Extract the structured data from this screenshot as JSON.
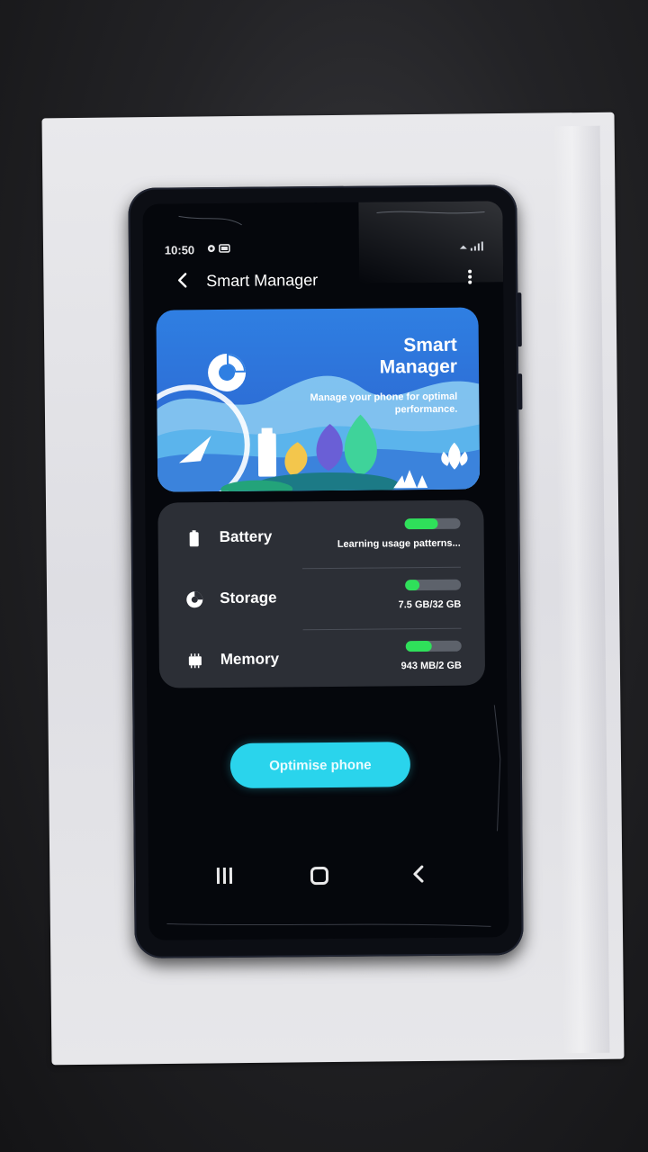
{
  "status_bar": {
    "time": "10:50",
    "icons": [
      "gear-icon",
      "gallery-icon"
    ],
    "signal": [
      "wifi-icon",
      "signal-icon"
    ]
  },
  "app_bar": {
    "title": "Smart Manager"
  },
  "hero": {
    "title_line1": "Smart",
    "title_line2": "Manager",
    "subtitle": "Manage your phone for optimal performance."
  },
  "status_items": [
    {
      "label": "Battery",
      "value": "Learning usage patterns...",
      "level": 0.6,
      "icon": "battery-icon"
    },
    {
      "label": "Storage",
      "value_used": "7.5 GB",
      "value_total": "/32 GB",
      "level": 0.25,
      "icon": "storage-icon"
    },
    {
      "label": "Memory",
      "value_used": "943 MB",
      "value_total": "/2 GB",
      "level": 0.47,
      "icon": "memory-icon"
    }
  ],
  "action": {
    "label": "Optimise phone"
  },
  "colors": {
    "accent": "#2ad4ec",
    "bar_fill": "#2fe05a",
    "hero_blue": "#2f7fe2",
    "card_bg": "#2c2f36"
  }
}
